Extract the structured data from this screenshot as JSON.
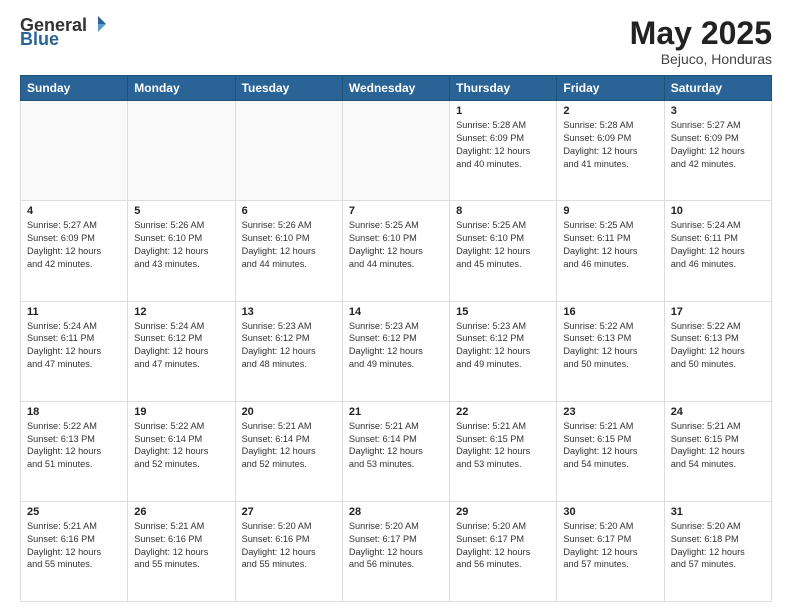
{
  "header": {
    "logo": {
      "general": "General",
      "blue": "Blue"
    },
    "title": "May 2025",
    "location": "Bejuco, Honduras"
  },
  "weekdays": [
    "Sunday",
    "Monday",
    "Tuesday",
    "Wednesday",
    "Thursday",
    "Friday",
    "Saturday"
  ],
  "weeks": [
    [
      {
        "day": "",
        "info": ""
      },
      {
        "day": "",
        "info": ""
      },
      {
        "day": "",
        "info": ""
      },
      {
        "day": "",
        "info": ""
      },
      {
        "day": "1",
        "info": "Sunrise: 5:28 AM\nSunset: 6:09 PM\nDaylight: 12 hours\nand 40 minutes."
      },
      {
        "day": "2",
        "info": "Sunrise: 5:28 AM\nSunset: 6:09 PM\nDaylight: 12 hours\nand 41 minutes."
      },
      {
        "day": "3",
        "info": "Sunrise: 5:27 AM\nSunset: 6:09 PM\nDaylight: 12 hours\nand 42 minutes."
      }
    ],
    [
      {
        "day": "4",
        "info": "Sunrise: 5:27 AM\nSunset: 6:09 PM\nDaylight: 12 hours\nand 42 minutes."
      },
      {
        "day": "5",
        "info": "Sunrise: 5:26 AM\nSunset: 6:10 PM\nDaylight: 12 hours\nand 43 minutes."
      },
      {
        "day": "6",
        "info": "Sunrise: 5:26 AM\nSunset: 6:10 PM\nDaylight: 12 hours\nand 44 minutes."
      },
      {
        "day": "7",
        "info": "Sunrise: 5:25 AM\nSunset: 6:10 PM\nDaylight: 12 hours\nand 44 minutes."
      },
      {
        "day": "8",
        "info": "Sunrise: 5:25 AM\nSunset: 6:10 PM\nDaylight: 12 hours\nand 45 minutes."
      },
      {
        "day": "9",
        "info": "Sunrise: 5:25 AM\nSunset: 6:11 PM\nDaylight: 12 hours\nand 46 minutes."
      },
      {
        "day": "10",
        "info": "Sunrise: 5:24 AM\nSunset: 6:11 PM\nDaylight: 12 hours\nand 46 minutes."
      }
    ],
    [
      {
        "day": "11",
        "info": "Sunrise: 5:24 AM\nSunset: 6:11 PM\nDaylight: 12 hours\nand 47 minutes."
      },
      {
        "day": "12",
        "info": "Sunrise: 5:24 AM\nSunset: 6:12 PM\nDaylight: 12 hours\nand 47 minutes."
      },
      {
        "day": "13",
        "info": "Sunrise: 5:23 AM\nSunset: 6:12 PM\nDaylight: 12 hours\nand 48 minutes."
      },
      {
        "day": "14",
        "info": "Sunrise: 5:23 AM\nSunset: 6:12 PM\nDaylight: 12 hours\nand 49 minutes."
      },
      {
        "day": "15",
        "info": "Sunrise: 5:23 AM\nSunset: 6:12 PM\nDaylight: 12 hours\nand 49 minutes."
      },
      {
        "day": "16",
        "info": "Sunrise: 5:22 AM\nSunset: 6:13 PM\nDaylight: 12 hours\nand 50 minutes."
      },
      {
        "day": "17",
        "info": "Sunrise: 5:22 AM\nSunset: 6:13 PM\nDaylight: 12 hours\nand 50 minutes."
      }
    ],
    [
      {
        "day": "18",
        "info": "Sunrise: 5:22 AM\nSunset: 6:13 PM\nDaylight: 12 hours\nand 51 minutes."
      },
      {
        "day": "19",
        "info": "Sunrise: 5:22 AM\nSunset: 6:14 PM\nDaylight: 12 hours\nand 52 minutes."
      },
      {
        "day": "20",
        "info": "Sunrise: 5:21 AM\nSunset: 6:14 PM\nDaylight: 12 hours\nand 52 minutes."
      },
      {
        "day": "21",
        "info": "Sunrise: 5:21 AM\nSunset: 6:14 PM\nDaylight: 12 hours\nand 53 minutes."
      },
      {
        "day": "22",
        "info": "Sunrise: 5:21 AM\nSunset: 6:15 PM\nDaylight: 12 hours\nand 53 minutes."
      },
      {
        "day": "23",
        "info": "Sunrise: 5:21 AM\nSunset: 6:15 PM\nDaylight: 12 hours\nand 54 minutes."
      },
      {
        "day": "24",
        "info": "Sunrise: 5:21 AM\nSunset: 6:15 PM\nDaylight: 12 hours\nand 54 minutes."
      }
    ],
    [
      {
        "day": "25",
        "info": "Sunrise: 5:21 AM\nSunset: 6:16 PM\nDaylight: 12 hours\nand 55 minutes."
      },
      {
        "day": "26",
        "info": "Sunrise: 5:21 AM\nSunset: 6:16 PM\nDaylight: 12 hours\nand 55 minutes."
      },
      {
        "day": "27",
        "info": "Sunrise: 5:20 AM\nSunset: 6:16 PM\nDaylight: 12 hours\nand 55 minutes."
      },
      {
        "day": "28",
        "info": "Sunrise: 5:20 AM\nSunset: 6:17 PM\nDaylight: 12 hours\nand 56 minutes."
      },
      {
        "day": "29",
        "info": "Sunrise: 5:20 AM\nSunset: 6:17 PM\nDaylight: 12 hours\nand 56 minutes."
      },
      {
        "day": "30",
        "info": "Sunrise: 5:20 AM\nSunset: 6:17 PM\nDaylight: 12 hours\nand 57 minutes."
      },
      {
        "day": "31",
        "info": "Sunrise: 5:20 AM\nSunset: 6:18 PM\nDaylight: 12 hours\nand 57 minutes."
      }
    ]
  ]
}
